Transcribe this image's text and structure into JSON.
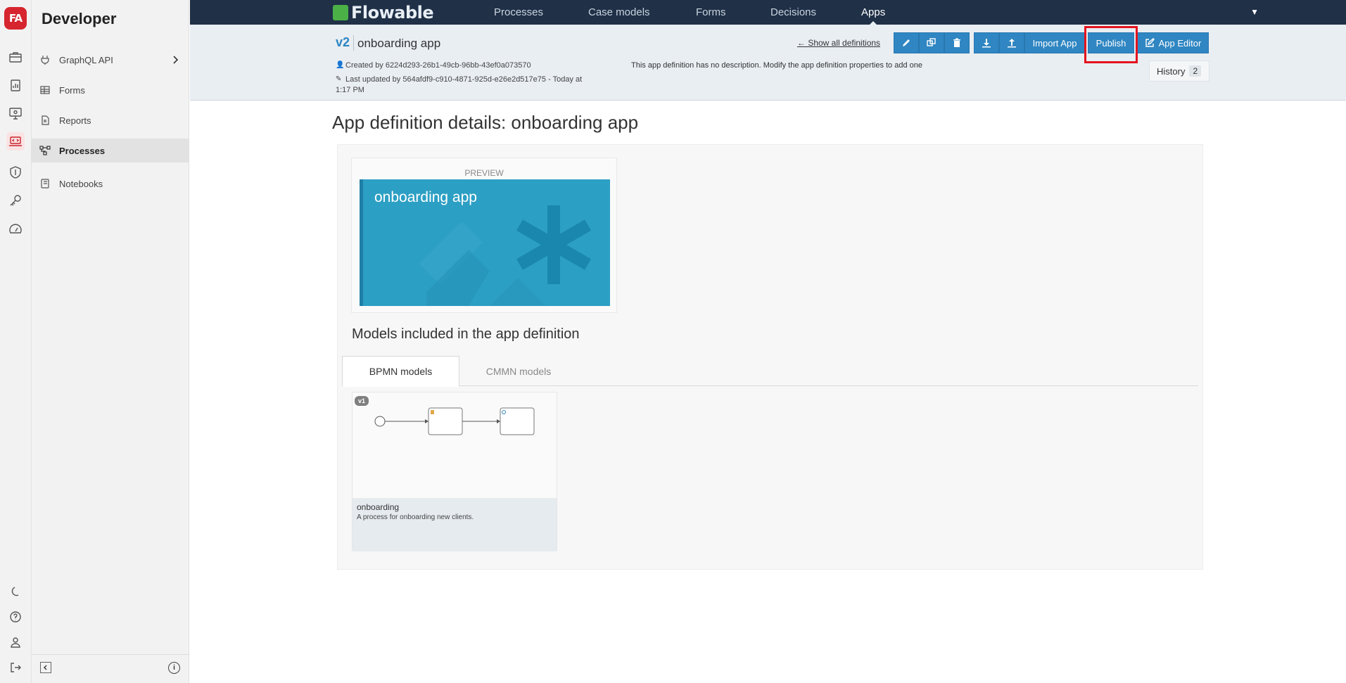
{
  "rail": {
    "logo": "FA",
    "icons": [
      "briefcase-icon",
      "clipboard-chart-icon",
      "monitor-settings-icon",
      "laptop-code-icon",
      "shield-icon",
      "key-icon",
      "gauge-icon"
    ],
    "bottom_icons": [
      "moon-icon",
      "help-icon",
      "user-icon",
      "logout-icon"
    ]
  },
  "sidebar": {
    "title": "Developer",
    "items": [
      {
        "label": "GraphQL API",
        "icon": "plug-icon"
      },
      {
        "label": "Forms",
        "icon": "table-icon"
      },
      {
        "label": "Reports",
        "icon": "report-icon"
      },
      {
        "label": "Processes",
        "icon": "process-icon"
      },
      {
        "label": "Notebooks",
        "icon": "notebook-icon"
      }
    ]
  },
  "topnav": {
    "brand": "Flowable",
    "items": [
      "Processes",
      "Case models",
      "Forms",
      "Decisions",
      "Apps"
    ],
    "active": "Apps"
  },
  "header": {
    "version": "v2",
    "app_name": "onboarding app",
    "created_by": "Created by 6224d293-26b1-49cb-96bb-43ef0a073570",
    "updated_by_1": "Last updated by 564afdf9-c910-4871-925d-e26e2d517e75 - Today at",
    "updated_by_2": "1:17 PM",
    "description": "This app definition has no description. Modify the app definition properties to add one",
    "show_all": "← Show all definitions",
    "buttons": {
      "import_app": "Import App",
      "publish": "Publish",
      "app_editor": "App Editor"
    },
    "history_label": "History",
    "history_count": "2"
  },
  "page_title": "App definition details: onboarding app",
  "preview": {
    "label": "PREVIEW",
    "tile_name": "onboarding app",
    "tile_color": "#2c9fc4"
  },
  "models": {
    "title": "Models included in the app definition",
    "tabs": [
      "BPMN models",
      "CMMN models"
    ],
    "active_tab": "BPMN models",
    "cards": [
      {
        "version": "v1",
        "name": "onboarding",
        "description": "A process for onboarding new clients."
      }
    ]
  },
  "colors": {
    "primary": "#2f86c2",
    "nav_bg": "#1f3047",
    "highlight": "#e3141e"
  }
}
